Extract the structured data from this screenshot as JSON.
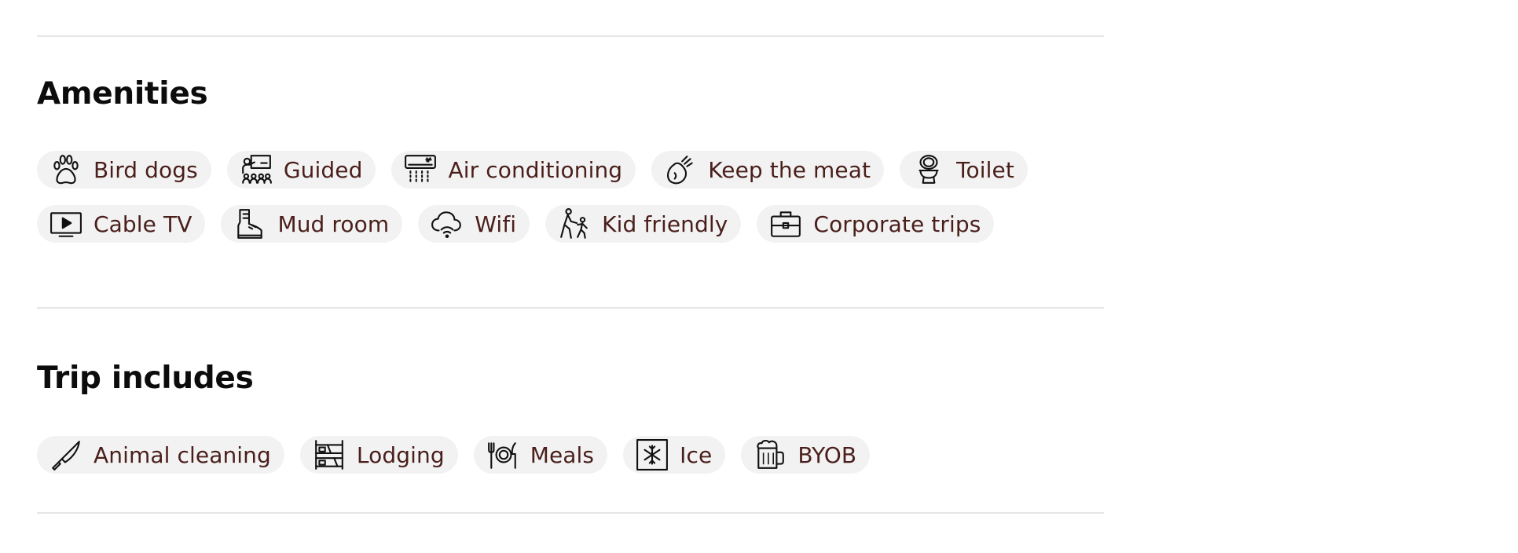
{
  "amenities": {
    "title": "Amenities",
    "items": [
      {
        "label": "Bird dogs",
        "icon": "paw-icon"
      },
      {
        "label": "Guided",
        "icon": "guide-icon"
      },
      {
        "label": "Air conditioning",
        "icon": "air-conditioner-icon"
      },
      {
        "label": "Keep the meat",
        "icon": "meat-icon"
      },
      {
        "label": "Toilet",
        "icon": "toilet-icon"
      },
      {
        "label": "Cable TV",
        "icon": "tv-icon"
      },
      {
        "label": "Mud room",
        "icon": "boot-icon"
      },
      {
        "label": "Wifi",
        "icon": "wifi-cloud-icon"
      },
      {
        "label": "Kid friendly",
        "icon": "family-walk-icon"
      },
      {
        "label": "Corporate trips",
        "icon": "briefcase-icon"
      }
    ]
  },
  "trip_includes": {
    "title": "Trip includes",
    "items": [
      {
        "label": "Animal cleaning",
        "icon": "knife-icon"
      },
      {
        "label": "Lodging",
        "icon": "bunk-bed-icon"
      },
      {
        "label": "Meals",
        "icon": "plate-cutlery-icon"
      },
      {
        "label": "Ice",
        "icon": "ice-icon"
      },
      {
        "label": "BYOB",
        "icon": "beer-mug-icon"
      }
    ]
  },
  "colors": {
    "chip_background": "#f2f2f2",
    "chip_text": "#4a1f1b",
    "divider": "#e6e6e6",
    "heading": "#0c0c0c"
  }
}
